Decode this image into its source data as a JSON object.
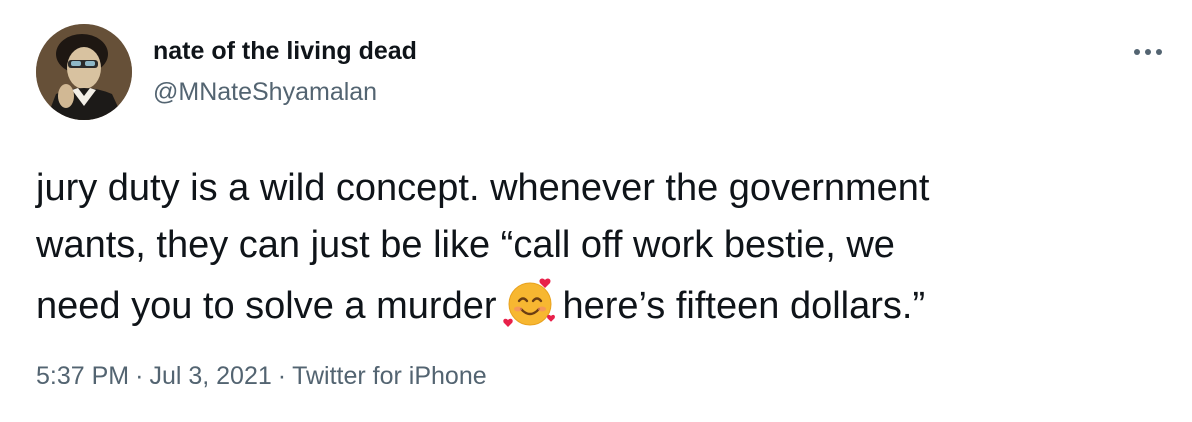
{
  "author": {
    "display_name": "nate of the living dead",
    "handle": "@MNateShyamalan",
    "avatar_icon": "painted-portrait-avatar"
  },
  "menu": {
    "icon": "more-horizontal-icon"
  },
  "tweet": {
    "line1": "jury duty is a wild concept. whenever the government",
    "line2": "wants, they can just be like “call off work bestie, we",
    "line3_before": "need you to solve a murder",
    "emoji": "smiling-face-with-hearts",
    "line3_after": "here’s fifteen dollars.”"
  },
  "meta": {
    "time": "5:37 PM",
    "separator": "·",
    "date": "Jul 3, 2021",
    "source": "Twitter for iPhone"
  },
  "colors": {
    "text": "#0f1419",
    "secondary": "#536471",
    "emoji_face": "#f7b731",
    "emoji_heart": "#e8204a"
  }
}
